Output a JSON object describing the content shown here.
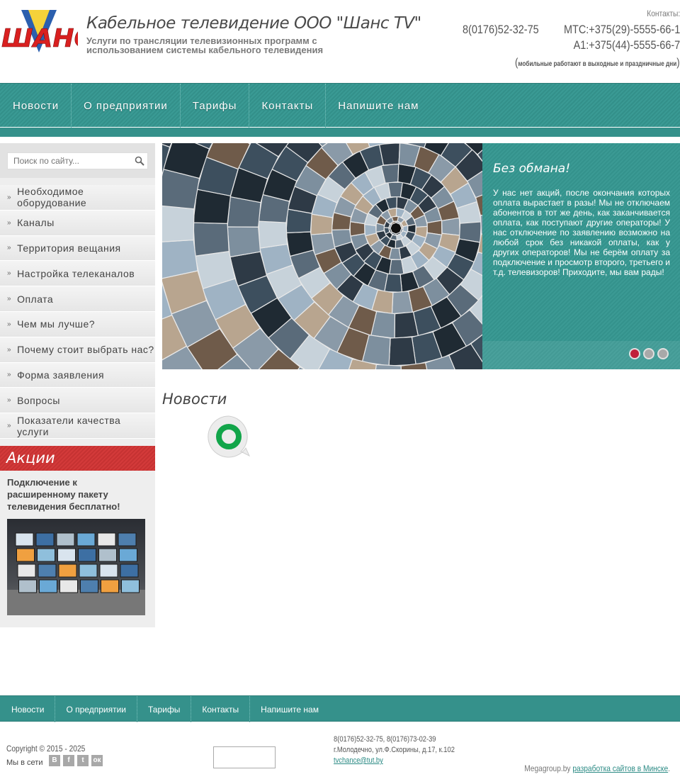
{
  "header": {
    "logo_text": "ШАНС",
    "title": "Кабельное телевидение ООО \"Шанс TV\"",
    "description": "Услуги по трансляции телевизионных программ с использованием системы кабельного телевидения",
    "contacts_label": "Контакты:",
    "phone_main": "8(0176)52-32-75",
    "phone_mts": "МТС:+375(29)-5555-66-1",
    "phone_a1": "А1:+375(44)-5555-66-7",
    "mobile_note": "мобильные работают в выходные и праздничные дни"
  },
  "topnav": [
    "Новости",
    "О предприятии",
    "Тарифы",
    "Контакты",
    "Напишите нам"
  ],
  "search": {
    "placeholder": "Поиск по сайту..."
  },
  "sidebar_menu": [
    "Необходимое оборудование",
    "Каналы",
    "Территория вещания",
    "Настройка телеканалов",
    "Оплата",
    "Чем мы лучше?",
    "Почему стоит выбрать нас?",
    "Форма заявления",
    "Вопросы",
    "Показатели качества услуги"
  ],
  "promo": {
    "heading": "Акции",
    "text": "Подключение к расширенному пакету телевидения бесплатно!"
  },
  "slider": {
    "title": "Без обмана!",
    "text": "У нас нет акций, после окончания которых оплата вырастает в разы! Мы не отключаем абонентов в тот же день, как заканчивается оплата, как поступают другие операторы! У нас отключение по заявлению возможно на любой срок без никакой оплаты, как у других операторов! Мы не берём оплату за подключение и просмотр второго, третьего и т.д. телевизоров! Приходите, мы вам рады!"
  },
  "news": {
    "title": "Новости"
  },
  "footnav": [
    "Новости",
    "О предприятии",
    "Тарифы",
    "Контакты",
    "Напишите нам"
  ],
  "footer": {
    "copyright": "Copyright © 2015 - 2025",
    "social_label": "Мы в сети",
    "phones": "8(0176)52-32-75, 8(0176)73-02-39",
    "address": "г.Молодечно, ул.Ф.Скорины, д.17, к.102",
    "email": "tvchance@tut.by",
    "megagroup_prefix": "Megagroup.by",
    "megagroup_link": "разработка сайтов в Минске",
    "megagroup_suffix": "."
  },
  "colors": {
    "teal": "#35918b",
    "red": "#c63232",
    "dot_active": "#c0203a"
  }
}
